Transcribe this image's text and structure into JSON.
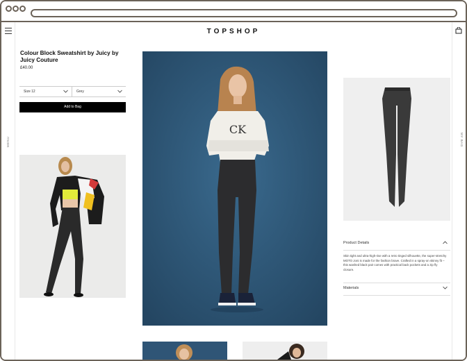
{
  "header": {
    "logo": "TOPSHOP",
    "menu_label": "MENU",
    "right_rail_label": "MY BAG"
  },
  "product": {
    "title": "Colour Block Sweatshirt by Juicy by Juicy Couture",
    "price": "£40.00",
    "size_select": "Size 12",
    "color_select": "Grey",
    "add_button": "Add to Bag"
  },
  "details": {
    "product_details_label": "Product Details",
    "description": "Skin tight and ultra-high-rise with a retro tinged silhouette, the super-stretchy MOTO Joni is made for the fashion brave. Crafted in a spray-on skinny fit – this washed black pair comes with practical back pockets and a zip fly closure.",
    "materials_label": "Materials"
  },
  "colors": {
    "blue_backdrop": "#2f5576",
    "frame": "#6b6258",
    "button_bg": "#000000"
  },
  "icons": {
    "menu": "hamburger-icon",
    "bag": "bag-icon",
    "chevron": "chevron-down-icon",
    "chevron_up": "chevron-up-icon"
  }
}
